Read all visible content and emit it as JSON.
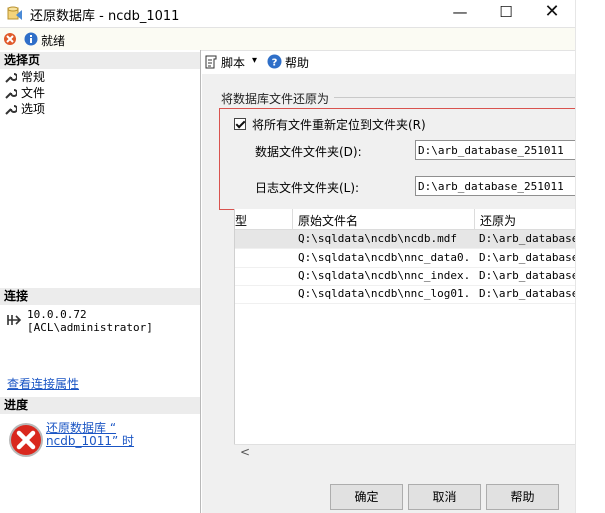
{
  "window": {
    "title": "还原数据库 - ncdb_1011",
    "min_glyph": "—",
    "max_glyph": "☐",
    "close_glyph": "✕"
  },
  "status": {
    "text": "就绪"
  },
  "left": {
    "select_page_header": "选择页",
    "pages": [
      "常规",
      "文件",
      "选项"
    ],
    "connection_header": "连接",
    "server": "10.0.0.72",
    "user": "[ACL\\administrator]",
    "view_connection_link": "查看连接属性",
    "progress_header": "进度",
    "progress_link_line1": "还原数据库 “",
    "progress_link_line2": "ncdb_1011” 时"
  },
  "toolbar": {
    "script_label": "脚本",
    "script_caret": "▾",
    "help_label": "帮助"
  },
  "relocate": {
    "group_title": "将数据库文件还原为",
    "checkbox_label": "将所有文件重新定位到文件夹(R)",
    "checkbox_checked": true,
    "data_folder_label": "数据文件文件夹(D):",
    "data_folder_value": "D:\\arb_database_251011",
    "log_folder_label": "日志文件文件夹(L):",
    "log_folder_value": "D:\\arb_database_251011"
  },
  "grid": {
    "columns": [
      "型",
      "原始文件名",
      "还原为"
    ],
    "rows": [
      {
        "original": "Q:\\sqldata\\ncdb\\ncdb.mdf",
        "restore_as": "D:\\arb_database_"
      },
      {
        "original": "Q:\\sqldata\\ncdb\\nnc_data0...",
        "restore_as": "D:\\arb_database_"
      },
      {
        "original": "Q:\\sqldata\\ncdb\\nnc_index...",
        "restore_as": "D:\\arb_database_"
      },
      {
        "original": "Q:\\sqldata\\ncdb\\nnc_log01...",
        "restore_as": "D:\\arb_database_"
      }
    ],
    "scroll_left_glyph": "<"
  },
  "buttons": {
    "ok": "确定",
    "cancel": "取消",
    "help": "帮助"
  },
  "colors": {
    "accent": "#1a55c4",
    "highlight_box": "#d9534f",
    "panel": "#f0f0f0"
  }
}
